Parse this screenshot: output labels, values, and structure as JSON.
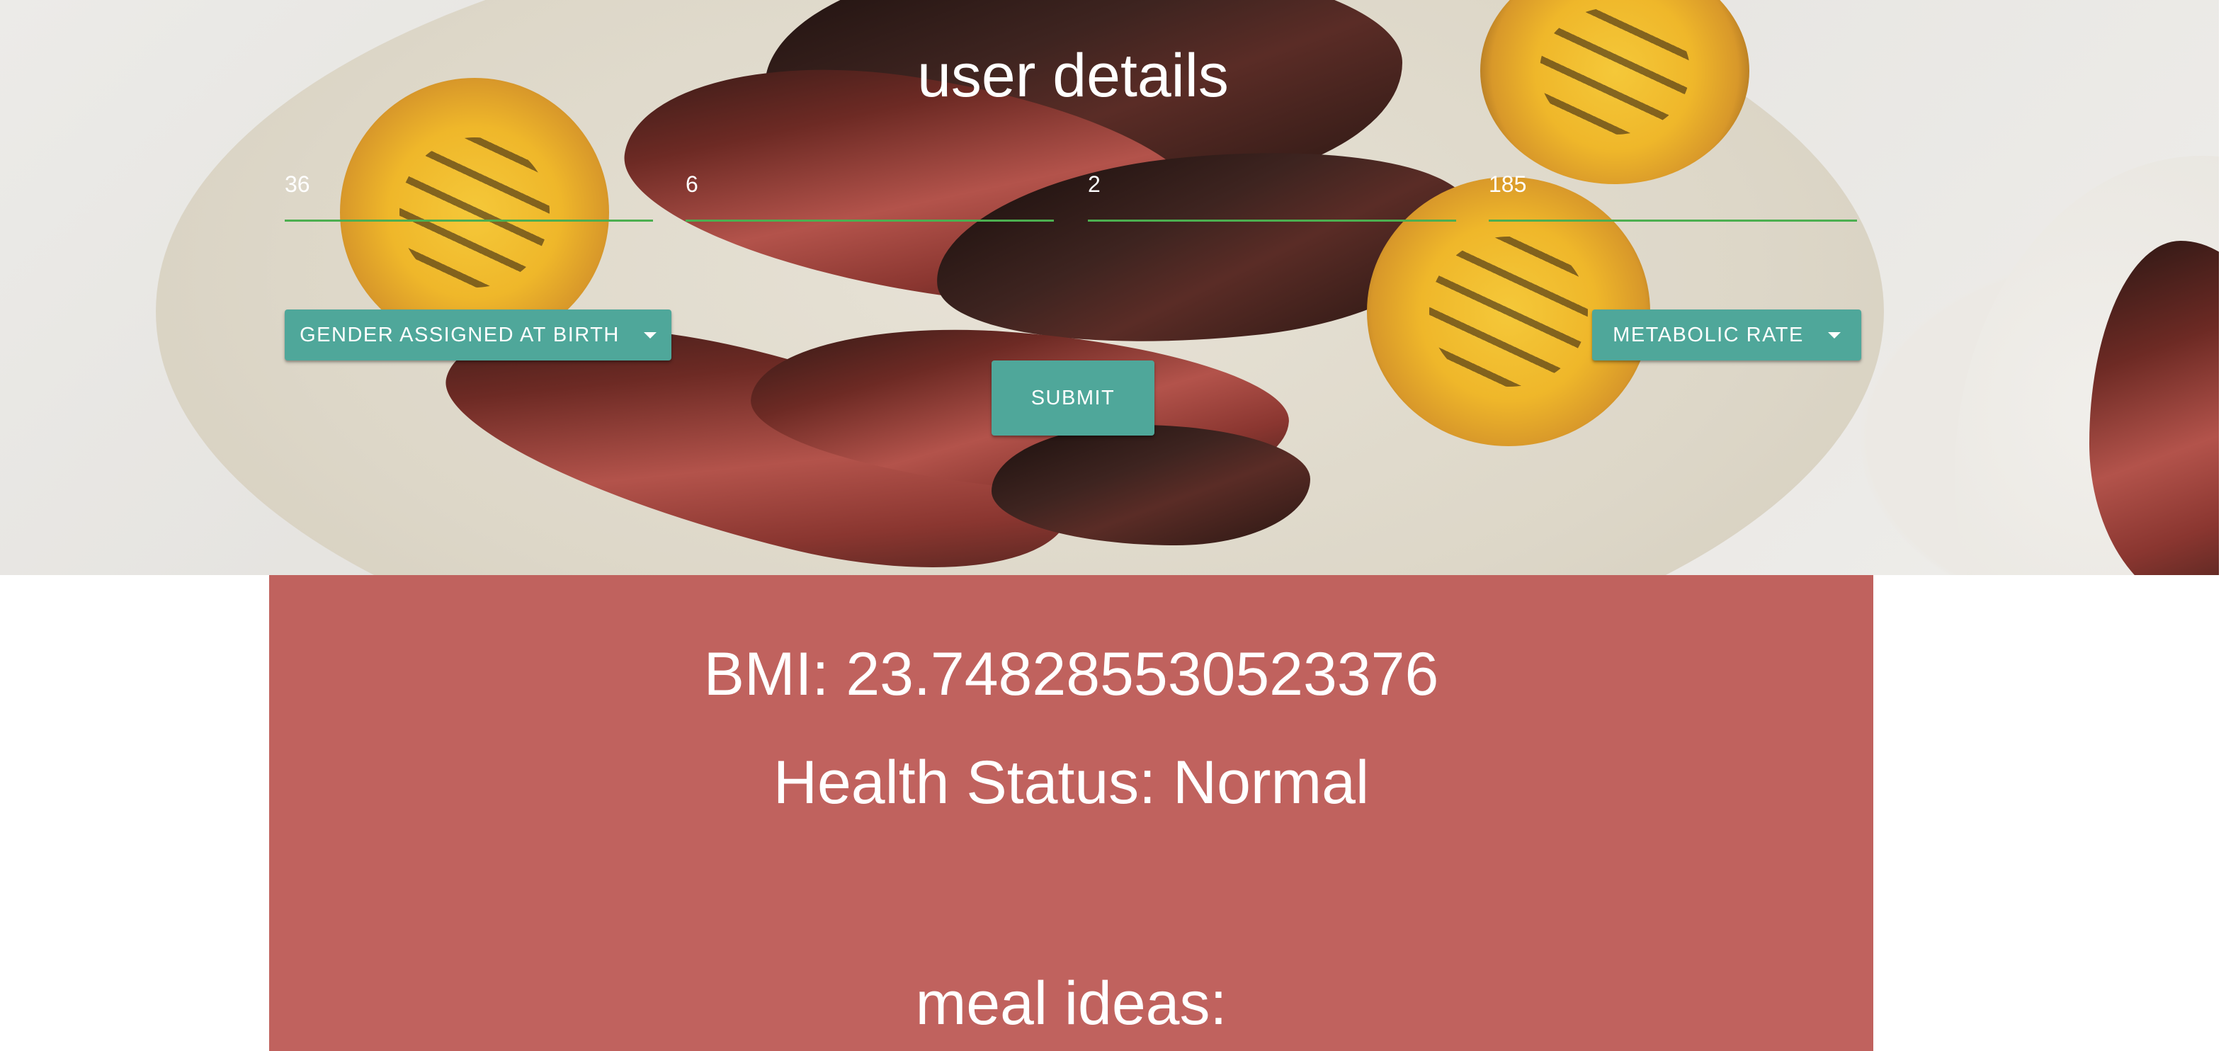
{
  "form": {
    "title": "user details",
    "fields": [
      {
        "value": "36"
      },
      {
        "value": "6"
      },
      {
        "value": "2"
      },
      {
        "value": "185"
      }
    ],
    "gender_dropdown_label": "GENDER ASSIGNED AT BIRTH",
    "metabolic_dropdown_label": "METABOLIC RATE",
    "submit_label": "SUBMIT"
  },
  "results": {
    "bmi_text": "BMI: 23.748285530523376",
    "health_text": "Health Status: Normal",
    "meal_heading": "meal ideas:"
  },
  "colors": {
    "accent_button": "#4fa79a",
    "field_underline": "#4caf50",
    "results_background": "#c0625e"
  },
  "icons": {
    "dropdown": "chevron-down-icon"
  }
}
